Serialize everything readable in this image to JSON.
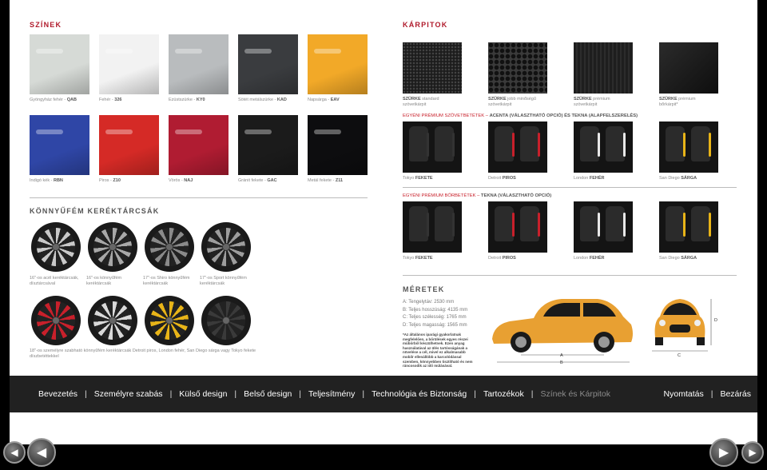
{
  "sections": {
    "colors_title": "SZÍNEK",
    "upholstery_title": "KÁRPITOK",
    "wheels_title": "KÖNNYŰFÉM KERÉKTÁRCSÁK",
    "dimensions_title": "MÉRETEK"
  },
  "colors_row1": [
    {
      "label": "Gyöngyház fehér - ",
      "code": "QAB",
      "color": "#d6dad6"
    },
    {
      "label": "Fehér - ",
      "code": "326",
      "color": "#f2f2f2"
    },
    {
      "label": "Ezüstszürke - ",
      "code": "KY0",
      "color": "#b9bcbe"
    },
    {
      "label": "Sötét metálszürke - ",
      "code": "KAD",
      "color": "#3a3c3f"
    },
    {
      "label": "Napsárga - ",
      "code": "EAV",
      "color": "#f2a928"
    }
  ],
  "colors_row2": [
    {
      "label": "Indigó kék - ",
      "code": "RBN",
      "color": "#2f46a6"
    },
    {
      "label": "Piros - ",
      "code": "Z10",
      "color": "#d52a26"
    },
    {
      "label": "Vörös - ",
      "code": "NAJ",
      "color": "#b01c32"
    },
    {
      "label": "Gránit fekete - ",
      "code": "GAC",
      "color": "#1b1b1b"
    },
    {
      "label": "Metál fekete - ",
      "code": "Z11",
      "color": "#0d0d0f"
    }
  ],
  "upholstery_fabric": [
    {
      "bold": "SZÜRKE",
      "text": " standard",
      "line2": "szövetkárpit"
    },
    {
      "bold": "SZÜRKE",
      "text": " jobb minőségű",
      "line2": "szövetkárpit"
    },
    {
      "bold": "SZÜRKE",
      "text": " prémium",
      "line2": "szövetkárpit"
    },
    {
      "bold": "SZÜRKE",
      "text": " prémium",
      "line2": "bőrkárpit*"
    }
  ],
  "premium_fabric_heading": {
    "red": "EGYÉNI PRÉMIUM SZÖVETBETÉTEK – ",
    "bold": "ACENTA (VÁLASZTHATÓ OPCIÓ) ÉS TEKNA (ALAPFELSZERELÉS)"
  },
  "premium_fabric": [
    {
      "city": "Tokyo ",
      "color": "FEKETE",
      "accent": "#333333"
    },
    {
      "city": "Detroit ",
      "color": "PIROS",
      "accent": "#c8202b"
    },
    {
      "city": "London ",
      "color": "FEHÉR",
      "accent": "#e8e8e8"
    },
    {
      "city": "San Diego ",
      "color": "SÁRGA",
      "accent": "#e8b418"
    }
  ],
  "premium_leather_heading": {
    "red": "EGYÉNI PRÉMIUM BŐRBETÉTEK – ",
    "bold": "TEKNA (VÁLASZTHATÓ OPCIÓ)"
  },
  "premium_leather": [
    {
      "city": "Tokyo ",
      "color": "FEKETE",
      "accent": "#333333"
    },
    {
      "city": "Detroit ",
      "color": "PIROS",
      "accent": "#c8202b"
    },
    {
      "city": "London ",
      "color": "FEHÉR",
      "accent": "#e8e8e8"
    },
    {
      "city": "San Diego ",
      "color": "SÁRGA",
      "accent": "#e8b418"
    }
  ],
  "wheels_row1": [
    {
      "line1": "16\"-os acél keréktárcsák,",
      "line2": "dísztárcsával",
      "rim": "#c8c8c8"
    },
    {
      "line1": "16\"-os könnyűfém",
      "line2": "keréktárcsák",
      "rim": "#a8a8a8"
    },
    {
      "line1": "17\"-os Shiro könnyűfém",
      "line2": "keréktárcsák",
      "rim": "#8a8a8a"
    },
    {
      "line1": "17\"-os Sport könnyűfém",
      "line2": "keréktárcsák",
      "rim": "#9d9d9d"
    }
  ],
  "wheels_row2": [
    {
      "rim": "#c8202b"
    },
    {
      "rim": "#d9d9d9"
    },
    {
      "rim": "#e8b418"
    },
    {
      "rim": "#3a3a3a"
    }
  ],
  "wheels_row2_caption": "18\"-os személyre szabható könnyűfém keréktárcsák Detroit piros, London fehér, San Diego sárga vagy Tokyo fekete díszbetéttekkel",
  "dimensions": [
    "A: Tengelytáv: 2530 mm",
    "B: Teljes hosszúság: 4135 mm",
    "C: Teljes szélesség: 1765 mm",
    "D: Teljes magasság: 1565 mm"
  ],
  "dimension_note": "*Az általános iparági gyakorlatnak megfelelően, a bőrülések egyes részei műbőrből készülhetnek. Ezen anyag használatával az ülés tartósságának a növelése a cél, mivel ez alkalmasabb mobilr ellenállóbb a karcolódással szemben, könnyebben tisztítható és nem ráncosodik az idő múlásával.",
  "dimension_labels": {
    "a": "A",
    "b": "B",
    "c": "C",
    "d": "D"
  },
  "car_color": "#e8a032",
  "nav": {
    "items": [
      "Bevezetés",
      "Személyre szabás",
      "Külső design",
      "Belső design",
      "Teljesítmény",
      "Technológia és Biztonság",
      "Tartozékok",
      "Színek és Kárpitok"
    ],
    "print": "Nyomtatás",
    "close": "Bezárás"
  }
}
